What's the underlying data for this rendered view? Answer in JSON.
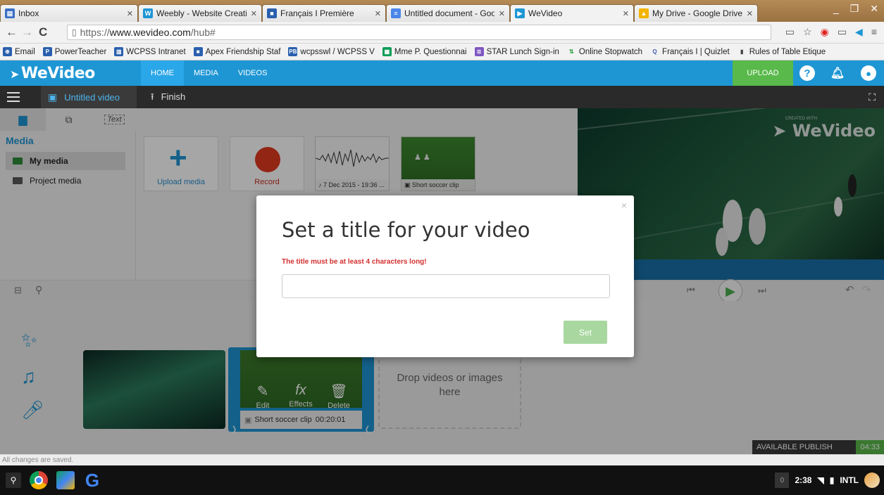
{
  "browser": {
    "tabs": [
      {
        "title": "Inbox",
        "color": "#3a6fc4"
      },
      {
        "title": "Weebly - Website Creati",
        "color": "#1e96d4"
      },
      {
        "title": "Français I Première",
        "color": "#2a5fae"
      },
      {
        "title": "Untitled document - Goo",
        "color": "#4a86e8"
      },
      {
        "title": "WeVideo",
        "color": "#1e96d4"
      },
      {
        "title": "My Drive - Google Drive",
        "color": "#f4b400"
      }
    ],
    "url_prefix": "https://",
    "url_host": "www.wevideo.com",
    "url_path": "/hub#",
    "bookmarks": [
      "Email",
      "PowerTeacher",
      "WCPSS Intranet",
      "Apex Friendship Staf",
      "wcpsswl / WCPSS V",
      "Mme P. Questionnai",
      "STAR Lunch Sign-in",
      "Online Stopwatch",
      "Français I | Quizlet",
      "Rules of Table Etique"
    ]
  },
  "app": {
    "logo": "WeVideo",
    "nav": [
      "HOME",
      "MEDIA",
      "VIDEOS"
    ],
    "upload_label": "UPLOAD",
    "project_title": "Untitled video",
    "finish_label": "Finish",
    "text_tab": "Text",
    "media_heading": "Media",
    "media_folders": [
      "My media",
      "Project media"
    ],
    "cards": {
      "upload": "Upload media",
      "record": "Record",
      "audio_caption": "7 Dec 2015 - 19:36 ...",
      "clip_caption": "Short soccer clip"
    },
    "preview_watermark": "WeVideo",
    "preview_watermark_small": "CREATED WITH",
    "timeline": {
      "clip_name": "Short soccer clip",
      "clip_duration": "00:20:01",
      "actions": [
        "Edit",
        "Effects",
        "Delete"
      ],
      "drop_text_1": "Drop videos or images",
      "drop_text_2": "here"
    },
    "publish_label": "AVAILABLE PUBLISH TIME",
    "publish_time": "04:33",
    "status_text": "All changes are saved.",
    "accent": "#1e96d4",
    "green": "#59b94a"
  },
  "dialog": {
    "title": "Set a title for your video",
    "error": "The title must be at least 4 characters long!",
    "input_value": "",
    "set_label": "Set",
    "close": "×"
  },
  "taskbar": {
    "badge": "0",
    "time": "2:38",
    "layout": "INTL"
  }
}
